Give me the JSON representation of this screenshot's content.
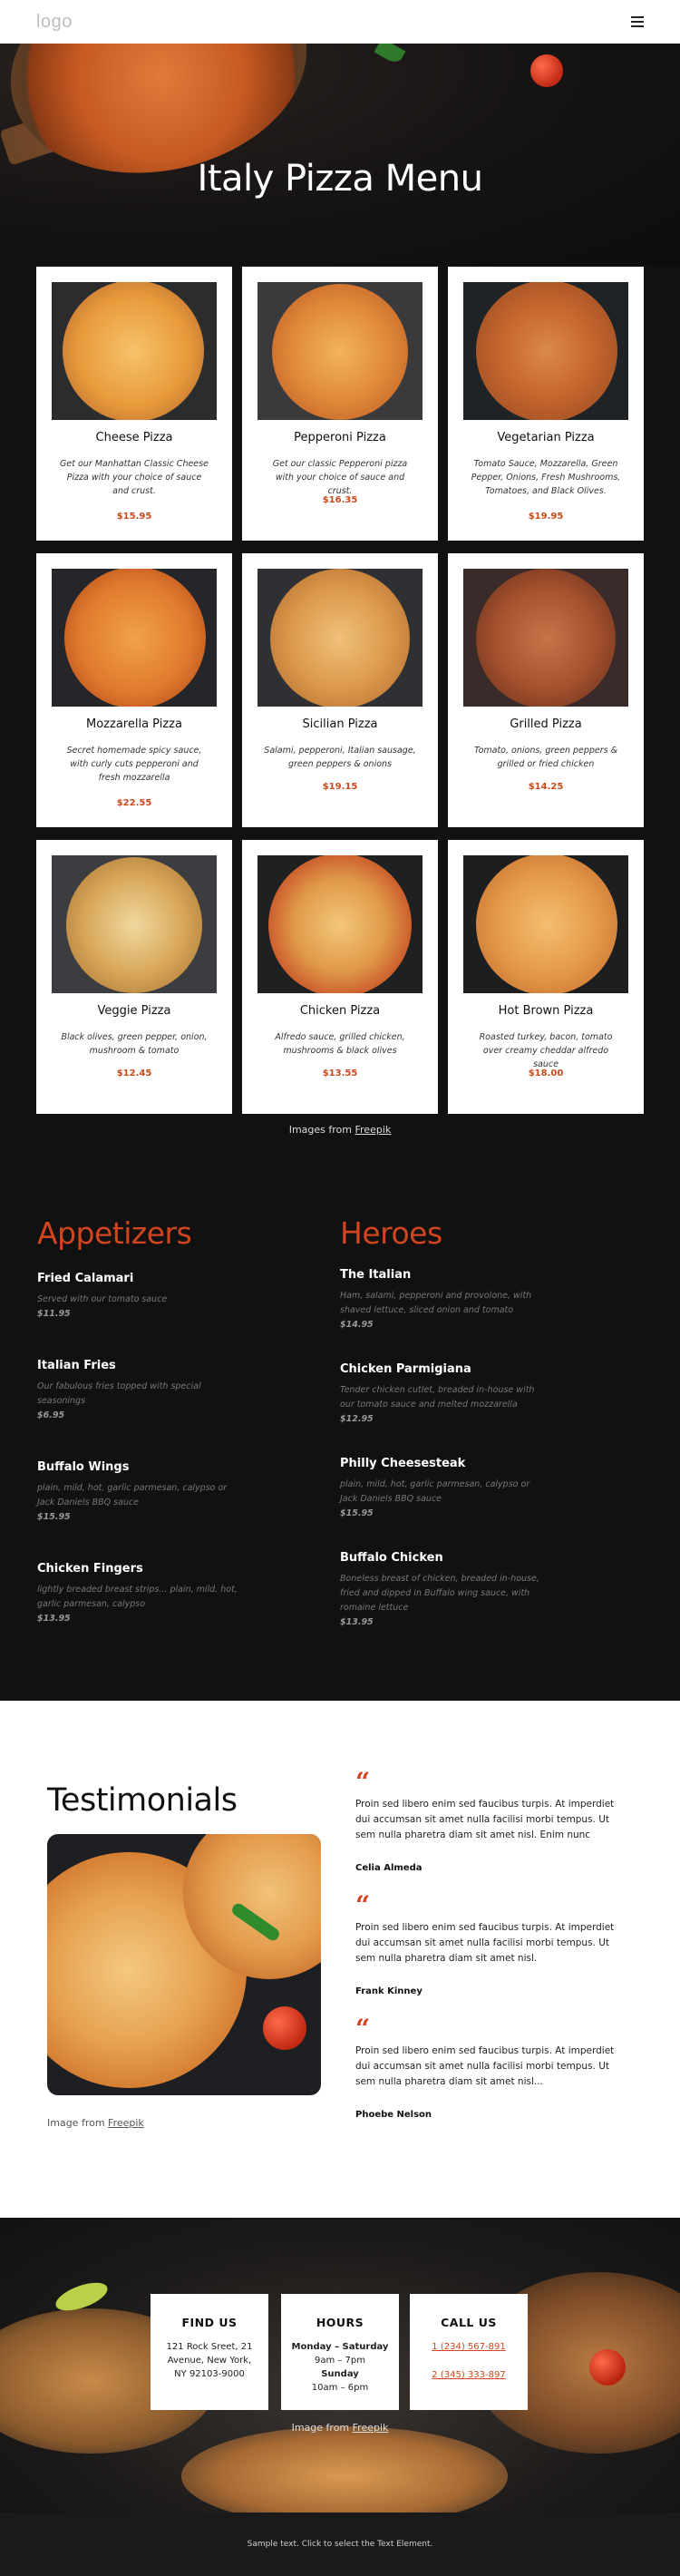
{
  "header": {
    "logo": "logo"
  },
  "hero": {
    "title": "Italy Pizza Menu"
  },
  "pizzas": [
    {
      "name": "Cheese Pizza",
      "desc": "Get our Manhattan Classic Cheese Pizza with your choice of sauce and crust.",
      "price": "$15.95"
    },
    {
      "name": "Pepperoni Pizza",
      "desc": "Get our classic Pepperoni pizza with your choice of sauce and crust.",
      "price": "$16.35"
    },
    {
      "name": "Vegetarian Pizza",
      "desc": "Tomato Sauce, Mozzarella, Green Pepper, Onions, Fresh Mushrooms, Tomatoes, and Black Olives.",
      "price": "$19.95"
    },
    {
      "name": "Mozzarella Pizza",
      "desc": "Secret homemade spicy sauce, with curly cuts pepperoni and fresh mozzarella",
      "price": "$22.55"
    },
    {
      "name": "Sicilian Pizza",
      "desc": "Salami, pepperoni, Italian sausage, green peppers & onions",
      "price": "$19.15"
    },
    {
      "name": "Grilled Pizza",
      "desc": "Tomato, onions, green peppers & grilled or fried chicken",
      "price": "$14.25"
    },
    {
      "name": "Veggie Pizza",
      "desc": "Black olives, green pepper, onion, mushroom & tomato",
      "price": "$12.45"
    },
    {
      "name": "Chicken Pizza",
      "desc": "Alfredo sauce, grilled chicken, mushrooms & black olives",
      "price": "$13.55"
    },
    {
      "name": "Hot Brown Pizza",
      "desc": "Roasted turkey, bacon, tomato over creamy cheddar alfredo sauce",
      "price": "$18.00"
    }
  ],
  "images_credit": {
    "prefix": "Images from ",
    "link": "Freepik"
  },
  "appetizers": {
    "title": "Appetizers",
    "items": [
      {
        "title": "Fried Calamari",
        "desc": "Served with our tomato sauce",
        "price": "$11.95"
      },
      {
        "title": "Italian Fries",
        "desc": "Our fabulous fries topped with special seasonings",
        "price": "$6.95"
      },
      {
        "title": "Buffalo Wings",
        "desc": "plain, mild, hot, garlic parmesan, calypso or Jack Daniels BBQ sauce",
        "price": "$15.95"
      },
      {
        "title": "Chicken Fingers",
        "desc": "lightly breaded breast strips... plain, mild, hot, garlic parmesan, calypso",
        "price": "$13.95"
      }
    ]
  },
  "heroes": {
    "title": "Heroes",
    "items": [
      {
        "title": "The Italian",
        "desc": "Ham, salami, pepperoni and provolone, with shaved lettuce, sliced onion and tomato",
        "price": "$14.95"
      },
      {
        "title": "Chicken Parmigiana",
        "desc": "Tender chicken cutlet, breaded in-house with our tomato sauce and melted mozzarella",
        "price": "$12.95"
      },
      {
        "title": "Philly Cheesesteak",
        "desc": "plain, mild, hot, garlic parmesan, calypso or Jack Daniels BBQ sauce",
        "price": "$15.95"
      },
      {
        "title": "Buffalo Chicken",
        "desc": "Boneless breast of chicken, breaded in-house, fried and dipped in Buffalo wing sauce, with romaine lettuce",
        "price": "$13.95"
      }
    ]
  },
  "testimonials": {
    "title": "Testimonials",
    "credit_prefix": "Image from ",
    "credit_link": "Freepik",
    "quotes": [
      {
        "text": "Proin sed libero enim sed faucibus turpis. At imperdiet dui accumsan sit amet nulla facilisi morbi tempus. Ut sem nulla pharetra diam sit amet nisl. Enim nunc",
        "author": "Celia Almeda"
      },
      {
        "text": "Proin sed libero enim sed faucibus turpis. At imperdiet dui accumsan sit amet nulla facilisi morbi tempus. Ut sem nulla pharetra diam sit amet nisl.",
        "author": "Frank Kinney"
      },
      {
        "text": "Proin sed libero enim sed faucibus turpis. At imperdiet dui accumsan sit amet nulla facilisi morbi tempus. Ut sem nulla pharetra diam sit amet nisl...",
        "author": "Phoebe Nelson"
      }
    ]
  },
  "contact": {
    "find_us": {
      "title": "FIND US",
      "line1": "121 Rock Sreet, 21",
      "line2": "Avenue, New York,",
      "line3": "NY 92103-9000"
    },
    "hours": {
      "title": "HOURS",
      "days1": "Monday – Saturday",
      "time1": "9am – 7pm",
      "days2": "Sunday",
      "time2": "10am – 6pm"
    },
    "call_us": {
      "title": "CALL US",
      "phone1": "1 (234) 567-891",
      "phone2": "2 (345) 333-897"
    },
    "credit_prefix": "Image from ",
    "credit_link": "Freepik"
  },
  "footer": {
    "text": "Sample text. Click to select the Text Element."
  }
}
